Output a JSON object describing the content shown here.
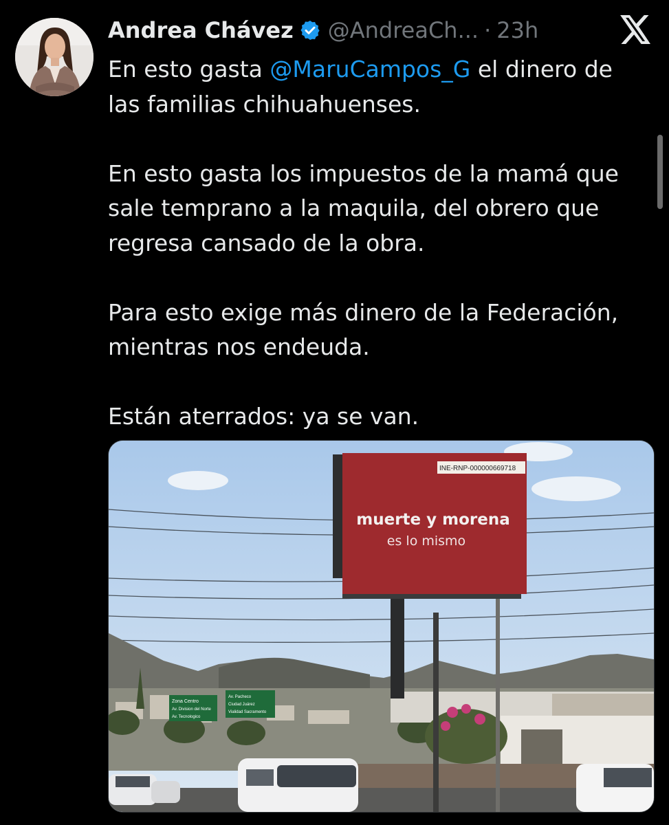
{
  "tweet": {
    "author_name": "Andrea Chávez",
    "handle": "@AndreaCh...",
    "separator": "·",
    "time": "23h",
    "text_parts": {
      "p1_a": "En esto gasta ",
      "p1_mention": "@MaruCampos_G",
      "p1_b": " el dinero de las familias chihuahuenses.",
      "p2": "En esto gasta los impuestos de la mamá que sale temprano a la maquila, del obrero que regresa cansado de la obra.",
      "p3": "Para esto exige más dinero de la Federación, mientras nos endeuda.",
      "p4": "Están aterrados: ya se van."
    }
  },
  "icons": {
    "verified": "verified-badge-icon",
    "x_logo": "x-logo-icon"
  },
  "media": {
    "billboard_tag": "INE-RNP-000000669718",
    "billboard_line1": "muerte y morena",
    "billboard_line2": "es lo mismo",
    "sign_left": [
      "Zona Centro",
      "Av. Division del Norte",
      "Av. Tecnologico"
    ],
    "sign_right": [
      "Av. Pacheco",
      "Ciudad Juárez",
      "Vialidad Sacramento"
    ]
  },
  "colors": {
    "background": "#000000",
    "text": "#e7e9ea",
    "muted": "#71767b",
    "link": "#1d9bf0",
    "billboard": "#9e2a2e"
  }
}
